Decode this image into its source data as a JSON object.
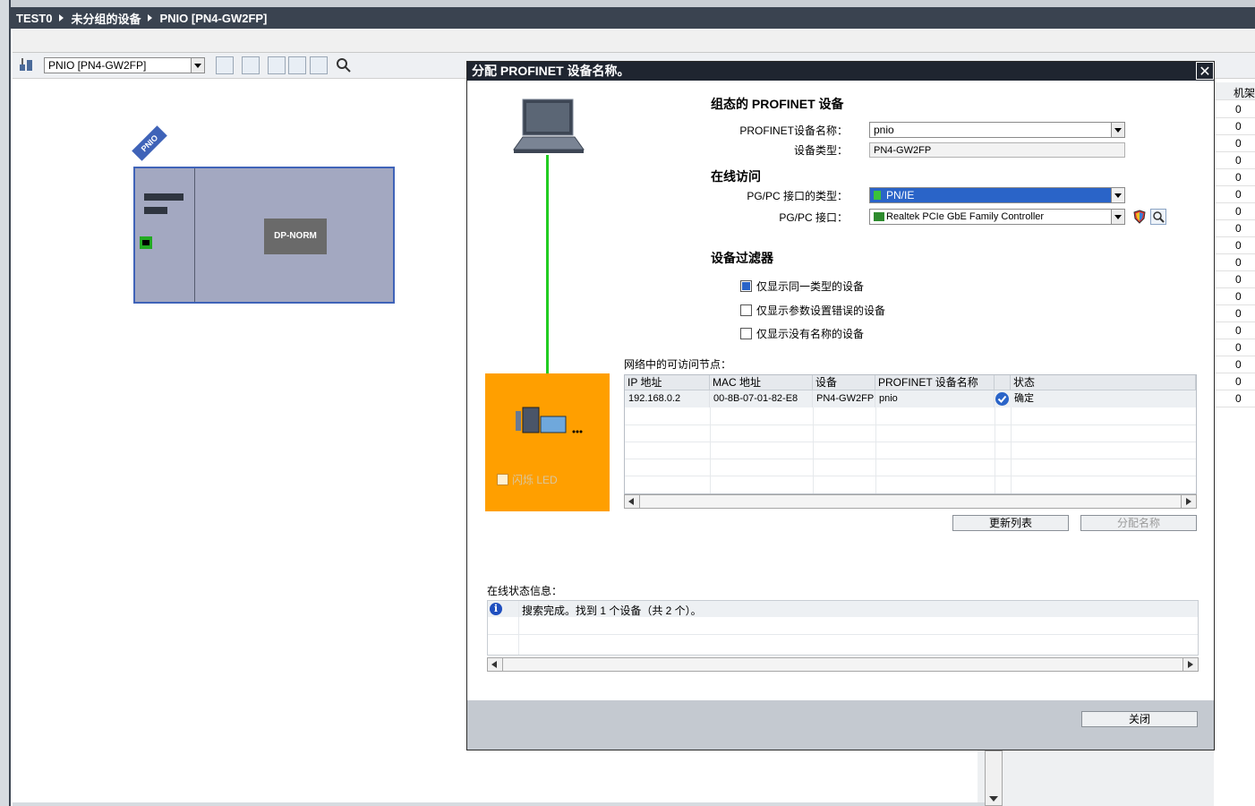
{
  "breadcrumb": {
    "items": [
      "TEST0",
      "未分组的设备",
      "PNIO [PN4-GW2FP]"
    ]
  },
  "toolbar": {
    "device_select": "PNIO [PN4-GW2FP]"
  },
  "device": {
    "tag": "PNIO",
    "module_label": "DP-NORM"
  },
  "right_grid": {
    "header": "机架",
    "values": [
      "0",
      "0",
      "0",
      "0",
      "0",
      "0",
      "0",
      "0",
      "0",
      "0",
      "0",
      "0",
      "0",
      "0",
      "0",
      "0",
      "0",
      "0"
    ]
  },
  "dialog": {
    "title": "分配 PROFINET 设备名称。",
    "close_symbol": "✕",
    "configured_heading": "组态的 PROFINET 设备",
    "device_name_label": "PROFINET设备名称：",
    "device_name_value": "pnio",
    "device_type_label": "设备类型：",
    "device_type_value": "PN4-GW2FP",
    "online_heading": "在线访问",
    "pgpc_type_label": "PG/PC 接口的类型：",
    "pgpc_type_value": "PN/IE",
    "pgpc_if_label": "PG/PC 接口：",
    "pgpc_if_value": "Realtek PCIe GbE Family Controller",
    "filter_heading": "设备过滤器",
    "filters": [
      {
        "label": "仅显示同一类型的设备",
        "checked": true
      },
      {
        "label": "仅显示参数设置错误的设备",
        "checked": false
      },
      {
        "label": "仅显示没有名称的设备",
        "checked": false
      }
    ],
    "flash_led_label": "闪烁 LED",
    "nodes_label": "网络中的可访问节点：",
    "columns": [
      "IP 地址",
      "MAC 地址",
      "设备",
      "PROFINET 设备名称",
      "",
      "状态"
    ],
    "rows": [
      {
        "ip": "192.168.0.2",
        "mac": "00-8B-07-01-82-E8",
        "device": "PN4-GW2FP",
        "name": "pnio",
        "status": "确定"
      }
    ],
    "update_button": "更新列表",
    "assign_button": "分配名称",
    "status_info_label": "在线状态信息：",
    "status_message": "搜索完成。找到 1 个设备（共 2 个）。",
    "close_button": "关闭"
  },
  "colors": {
    "accent": "#2a64c8",
    "title_bar": "#1f2530",
    "orange_panel": "#ff9f00",
    "link_green": "#22cc22"
  }
}
